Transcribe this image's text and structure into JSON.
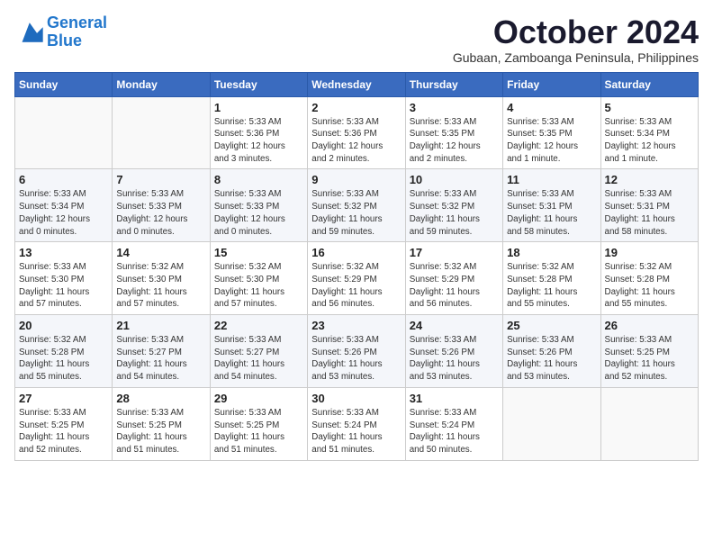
{
  "logo": {
    "line1": "General",
    "line2": "Blue"
  },
  "title": "October 2024",
  "subtitle": "Gubaan, Zamboanga Peninsula, Philippines",
  "weekdays": [
    "Sunday",
    "Monday",
    "Tuesday",
    "Wednesday",
    "Thursday",
    "Friday",
    "Saturday"
  ],
  "weeks": [
    [
      {
        "day": "",
        "info": ""
      },
      {
        "day": "",
        "info": ""
      },
      {
        "day": "1",
        "info": "Sunrise: 5:33 AM\nSunset: 5:36 PM\nDaylight: 12 hours\nand 3 minutes."
      },
      {
        "day": "2",
        "info": "Sunrise: 5:33 AM\nSunset: 5:36 PM\nDaylight: 12 hours\nand 2 minutes."
      },
      {
        "day": "3",
        "info": "Sunrise: 5:33 AM\nSunset: 5:35 PM\nDaylight: 12 hours\nand 2 minutes."
      },
      {
        "day": "4",
        "info": "Sunrise: 5:33 AM\nSunset: 5:35 PM\nDaylight: 12 hours\nand 1 minute."
      },
      {
        "day": "5",
        "info": "Sunrise: 5:33 AM\nSunset: 5:34 PM\nDaylight: 12 hours\nand 1 minute."
      }
    ],
    [
      {
        "day": "6",
        "info": "Sunrise: 5:33 AM\nSunset: 5:34 PM\nDaylight: 12 hours\nand 0 minutes."
      },
      {
        "day": "7",
        "info": "Sunrise: 5:33 AM\nSunset: 5:33 PM\nDaylight: 12 hours\nand 0 minutes."
      },
      {
        "day": "8",
        "info": "Sunrise: 5:33 AM\nSunset: 5:33 PM\nDaylight: 12 hours\nand 0 minutes."
      },
      {
        "day": "9",
        "info": "Sunrise: 5:33 AM\nSunset: 5:32 PM\nDaylight: 11 hours\nand 59 minutes."
      },
      {
        "day": "10",
        "info": "Sunrise: 5:33 AM\nSunset: 5:32 PM\nDaylight: 11 hours\nand 59 minutes."
      },
      {
        "day": "11",
        "info": "Sunrise: 5:33 AM\nSunset: 5:31 PM\nDaylight: 11 hours\nand 58 minutes."
      },
      {
        "day": "12",
        "info": "Sunrise: 5:33 AM\nSunset: 5:31 PM\nDaylight: 11 hours\nand 58 minutes."
      }
    ],
    [
      {
        "day": "13",
        "info": "Sunrise: 5:33 AM\nSunset: 5:30 PM\nDaylight: 11 hours\nand 57 minutes."
      },
      {
        "day": "14",
        "info": "Sunrise: 5:32 AM\nSunset: 5:30 PM\nDaylight: 11 hours\nand 57 minutes."
      },
      {
        "day": "15",
        "info": "Sunrise: 5:32 AM\nSunset: 5:30 PM\nDaylight: 11 hours\nand 57 minutes."
      },
      {
        "day": "16",
        "info": "Sunrise: 5:32 AM\nSunset: 5:29 PM\nDaylight: 11 hours\nand 56 minutes."
      },
      {
        "day": "17",
        "info": "Sunrise: 5:32 AM\nSunset: 5:29 PM\nDaylight: 11 hours\nand 56 minutes."
      },
      {
        "day": "18",
        "info": "Sunrise: 5:32 AM\nSunset: 5:28 PM\nDaylight: 11 hours\nand 55 minutes."
      },
      {
        "day": "19",
        "info": "Sunrise: 5:32 AM\nSunset: 5:28 PM\nDaylight: 11 hours\nand 55 minutes."
      }
    ],
    [
      {
        "day": "20",
        "info": "Sunrise: 5:32 AM\nSunset: 5:28 PM\nDaylight: 11 hours\nand 55 minutes."
      },
      {
        "day": "21",
        "info": "Sunrise: 5:33 AM\nSunset: 5:27 PM\nDaylight: 11 hours\nand 54 minutes."
      },
      {
        "day": "22",
        "info": "Sunrise: 5:33 AM\nSunset: 5:27 PM\nDaylight: 11 hours\nand 54 minutes."
      },
      {
        "day": "23",
        "info": "Sunrise: 5:33 AM\nSunset: 5:26 PM\nDaylight: 11 hours\nand 53 minutes."
      },
      {
        "day": "24",
        "info": "Sunrise: 5:33 AM\nSunset: 5:26 PM\nDaylight: 11 hours\nand 53 minutes."
      },
      {
        "day": "25",
        "info": "Sunrise: 5:33 AM\nSunset: 5:26 PM\nDaylight: 11 hours\nand 53 minutes."
      },
      {
        "day": "26",
        "info": "Sunrise: 5:33 AM\nSunset: 5:25 PM\nDaylight: 11 hours\nand 52 minutes."
      }
    ],
    [
      {
        "day": "27",
        "info": "Sunrise: 5:33 AM\nSunset: 5:25 PM\nDaylight: 11 hours\nand 52 minutes."
      },
      {
        "day": "28",
        "info": "Sunrise: 5:33 AM\nSunset: 5:25 PM\nDaylight: 11 hours\nand 51 minutes."
      },
      {
        "day": "29",
        "info": "Sunrise: 5:33 AM\nSunset: 5:25 PM\nDaylight: 11 hours\nand 51 minutes."
      },
      {
        "day": "30",
        "info": "Sunrise: 5:33 AM\nSunset: 5:24 PM\nDaylight: 11 hours\nand 51 minutes."
      },
      {
        "day": "31",
        "info": "Sunrise: 5:33 AM\nSunset: 5:24 PM\nDaylight: 11 hours\nand 50 minutes."
      },
      {
        "day": "",
        "info": ""
      },
      {
        "day": "",
        "info": ""
      }
    ]
  ]
}
